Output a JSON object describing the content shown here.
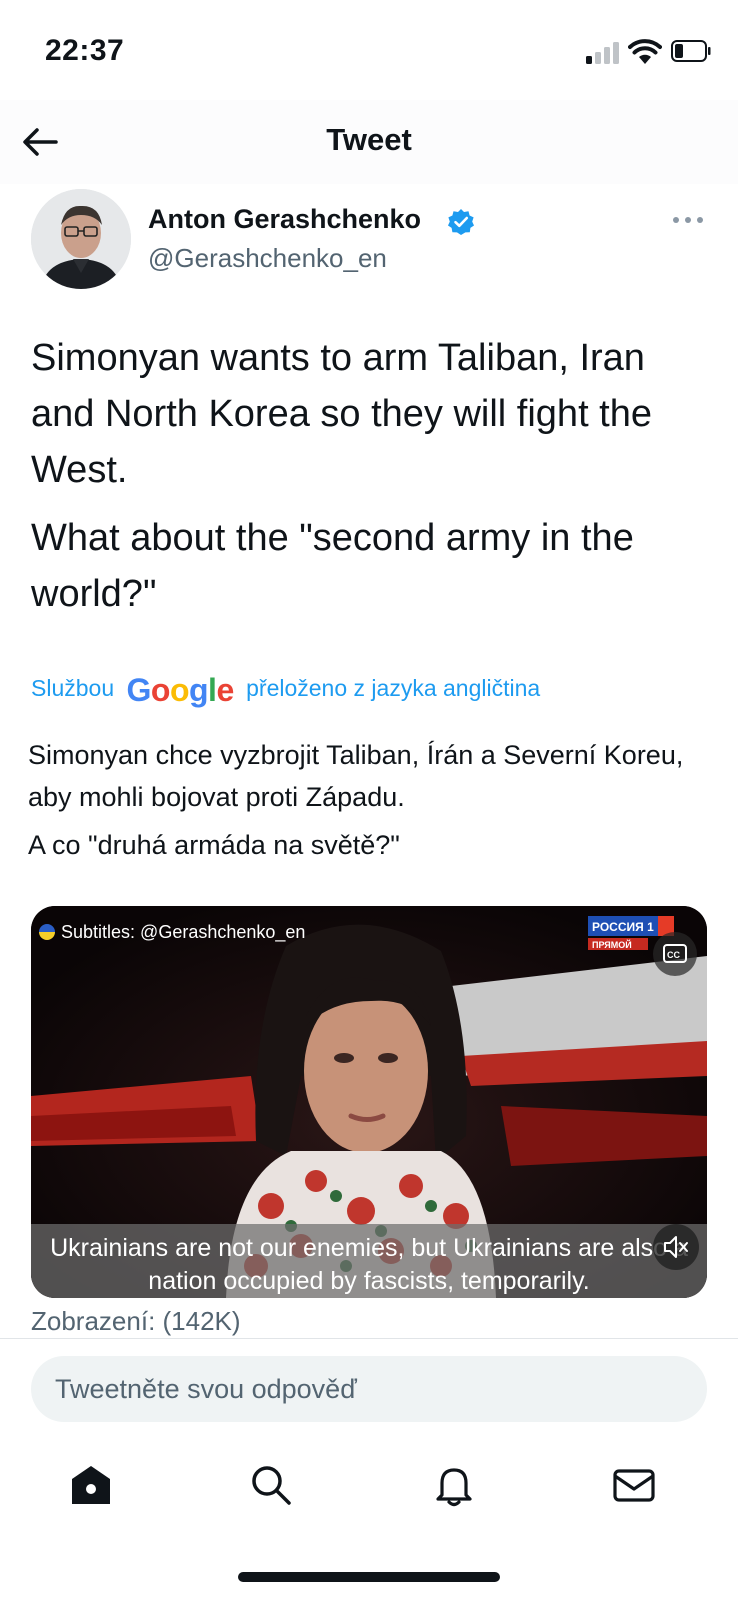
{
  "status_bar": {
    "time": "22:37"
  },
  "header": {
    "title": "Tweet"
  },
  "author": {
    "name": "Anton Gerashchenko",
    "handle": "@Gerashchenko_en",
    "verified": true
  },
  "tweet": {
    "paragraphs": [
      "Simonyan wants to arm Taliban, Iran and North Korea so they will fight the West.",
      "What about the \"second army in the world?\""
    ]
  },
  "translation": {
    "prefix": "Službou",
    "provider": "Google",
    "suffix": "přeloženo z jazyka angličtina",
    "paragraphs": [
      "Simonyan chce vyzbrojit Taliban, Írán a Severní Koreu, aby mohli bojovat proti Západu.",
      "A co \"druhá armáda na světě?\""
    ]
  },
  "video": {
    "subtitle_credit": "Subtitles: @Gerashchenko_en",
    "channel_logo_text": "РОССИЯ 1",
    "channel_sub_text": "ПРЯМОЙ",
    "subtitle": "Ukrainians are not our enemies, but Ukrainians are also a nation occupied by fascists, temporarily."
  },
  "views": "Zobrazení: (142K)",
  "reply": {
    "placeholder": "Tweetněte svou odpověď"
  },
  "tab_bar": {
    "items": [
      "home-icon",
      "search-icon",
      "bell-icon",
      "mail-icon"
    ]
  },
  "colors": {
    "accent": "#1d9bf0",
    "text": "#0f1419",
    "secondary": "#536471"
  }
}
